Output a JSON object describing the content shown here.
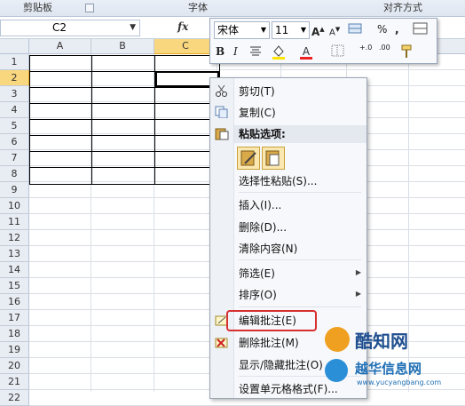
{
  "ribbon": {
    "groups": [
      "剪贴板",
      "字体",
      "对齐方式"
    ]
  },
  "formula_bar": {
    "name_box": "C2",
    "fx_label": "fx"
  },
  "sheet": {
    "columns": [
      "A",
      "B",
      "C"
    ],
    "rows": [
      "1",
      "2",
      "3",
      "4",
      "5",
      "6",
      "7",
      "8",
      "9",
      "10",
      "11",
      "12",
      "13",
      "14",
      "15",
      "16",
      "17",
      "18",
      "19",
      "20",
      "21",
      "22"
    ],
    "selected_column": "C",
    "selected_row": "2"
  },
  "mini_toolbar": {
    "font_name": "宋体",
    "font_size": "11",
    "bold": "B",
    "italic": "I",
    "percent": "%",
    "comma": ",",
    "increase_decimal": "+.0",
    "decrease_decimal": ".00"
  },
  "context_menu": {
    "items": [
      {
        "label": "剪切(T)",
        "icon": "scissors-icon"
      },
      {
        "label": "复制(C)",
        "icon": "copy-icon"
      },
      {
        "label": "粘贴选项:",
        "icon": "paste-icon",
        "bold": true
      },
      {
        "label": "选择性粘贴(S)..."
      },
      {
        "label": "插入(I)..."
      },
      {
        "label": "删除(D)..."
      },
      {
        "label": "清除内容(N)"
      },
      {
        "label": "筛选(E)",
        "submenu": true
      },
      {
        "label": "排序(O)",
        "submenu": true
      },
      {
        "label": "编辑批注(E)",
        "icon": "edit-comment-icon"
      },
      {
        "label": "删除批注(M)",
        "icon": "delete-comment-icon"
      },
      {
        "label": "显示/隐藏批注(O)"
      },
      {
        "label": "设置单元格格式(F)..."
      }
    ]
  },
  "watermark": {
    "line1": "酷知网",
    "line2": "越华信息网",
    "url": "www.yucyangbang.com"
  },
  "colors": {
    "selection_header": "#f8d77f",
    "highlight_box": "#d63030",
    "accent_blue": "#1f6fb5"
  }
}
